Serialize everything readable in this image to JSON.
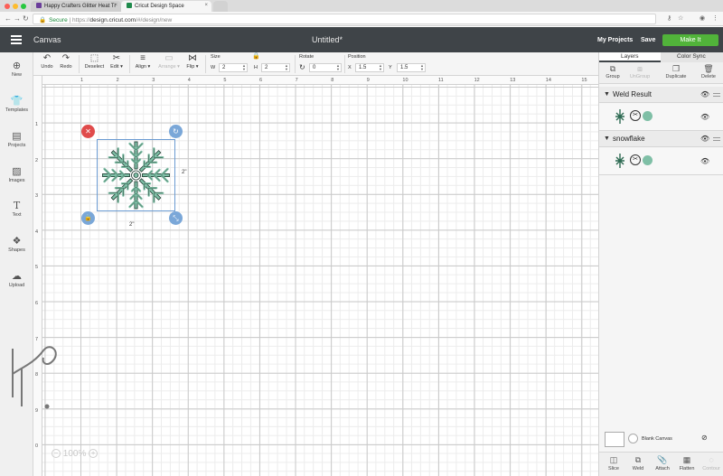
{
  "browser": {
    "tabs": [
      {
        "title": "Happy Crafters Glitter Heat Tr",
        "close": "×"
      },
      {
        "title": "Cricut Design Space",
        "close": "×"
      }
    ],
    "url": {
      "secure_label": "Secure",
      "separator": "|",
      "scheme": "https://",
      "host": "design.cricut.com",
      "path": "/#/design/new"
    }
  },
  "header": {
    "section": "Canvas",
    "project_title": "Untitled*",
    "my_projects": "My Projects",
    "save": "Save",
    "make_it": "Make It"
  },
  "toolbar": {
    "undo": "Undo",
    "redo": "Redo",
    "deselect": "Deselect",
    "edit": "Edit ▾",
    "align": "Align ▾",
    "arrange": "Arrange ▾",
    "flip": "Flip ▾",
    "size_label": "Size",
    "w_label": "W",
    "w_value": "2",
    "h_label": "H",
    "h_value": "2",
    "rotate_label": "Rotate",
    "rotate_value": "0",
    "position_label": "Position",
    "x_label": "X",
    "x_value": "1.5",
    "y_label": "Y",
    "y_value": "1.5"
  },
  "sidebar": {
    "items": [
      {
        "label": "New",
        "icon": "plus-circle-icon"
      },
      {
        "label": "Templates",
        "icon": "tshirt-icon"
      },
      {
        "label": "Projects",
        "icon": "projects-icon"
      },
      {
        "label": "Images",
        "icon": "image-icon"
      },
      {
        "label": "Text",
        "icon": "text-icon"
      },
      {
        "label": "Shapes",
        "icon": "shapes-icon"
      },
      {
        "label": "Upload",
        "icon": "cloud-upload-icon"
      }
    ]
  },
  "rulers": {
    "top": [
      "1",
      "2",
      "3",
      "4",
      "5",
      "6",
      "7",
      "8",
      "9",
      "10",
      "11",
      "12",
      "13",
      "14",
      "15"
    ],
    "left": [
      "1",
      "2",
      "3",
      "4",
      "5",
      "6",
      "7",
      "8",
      "9",
      "0"
    ]
  },
  "selection": {
    "width_label": "2\"",
    "height_label": "2\"",
    "snowflake_color": "#7fbfa6"
  },
  "zoom": {
    "minus": "−",
    "value": "100%",
    "plus": "+"
  },
  "layers_panel": {
    "tabs": [
      "Layers",
      "Color Sync"
    ],
    "actions": [
      {
        "label": "Group",
        "enabled": true
      },
      {
        "label": "UnGroup",
        "enabled": false
      },
      {
        "label": "Duplicate",
        "enabled": true
      },
      {
        "label": "Delete",
        "enabled": true
      }
    ],
    "groups": [
      {
        "name": "Weld Result",
        "color": "#7fbfa6"
      },
      {
        "name": "snowflake",
        "color": "#7fbfa6"
      }
    ],
    "blank_canvas_label": "Blank Canvas",
    "bottom_actions": [
      {
        "label": "Slice",
        "enabled": true
      },
      {
        "label": "Weld",
        "enabled": true
      },
      {
        "label": "Attach",
        "enabled": true
      },
      {
        "label": "Flatten",
        "enabled": true
      },
      {
        "label": "Contour",
        "enabled": false
      }
    ]
  },
  "colors": {
    "header_bg": "#3f4448",
    "make_it_green": "#51b33a",
    "delete_handle": "#e04b4b",
    "handle_blue": "#7aa7d8"
  }
}
